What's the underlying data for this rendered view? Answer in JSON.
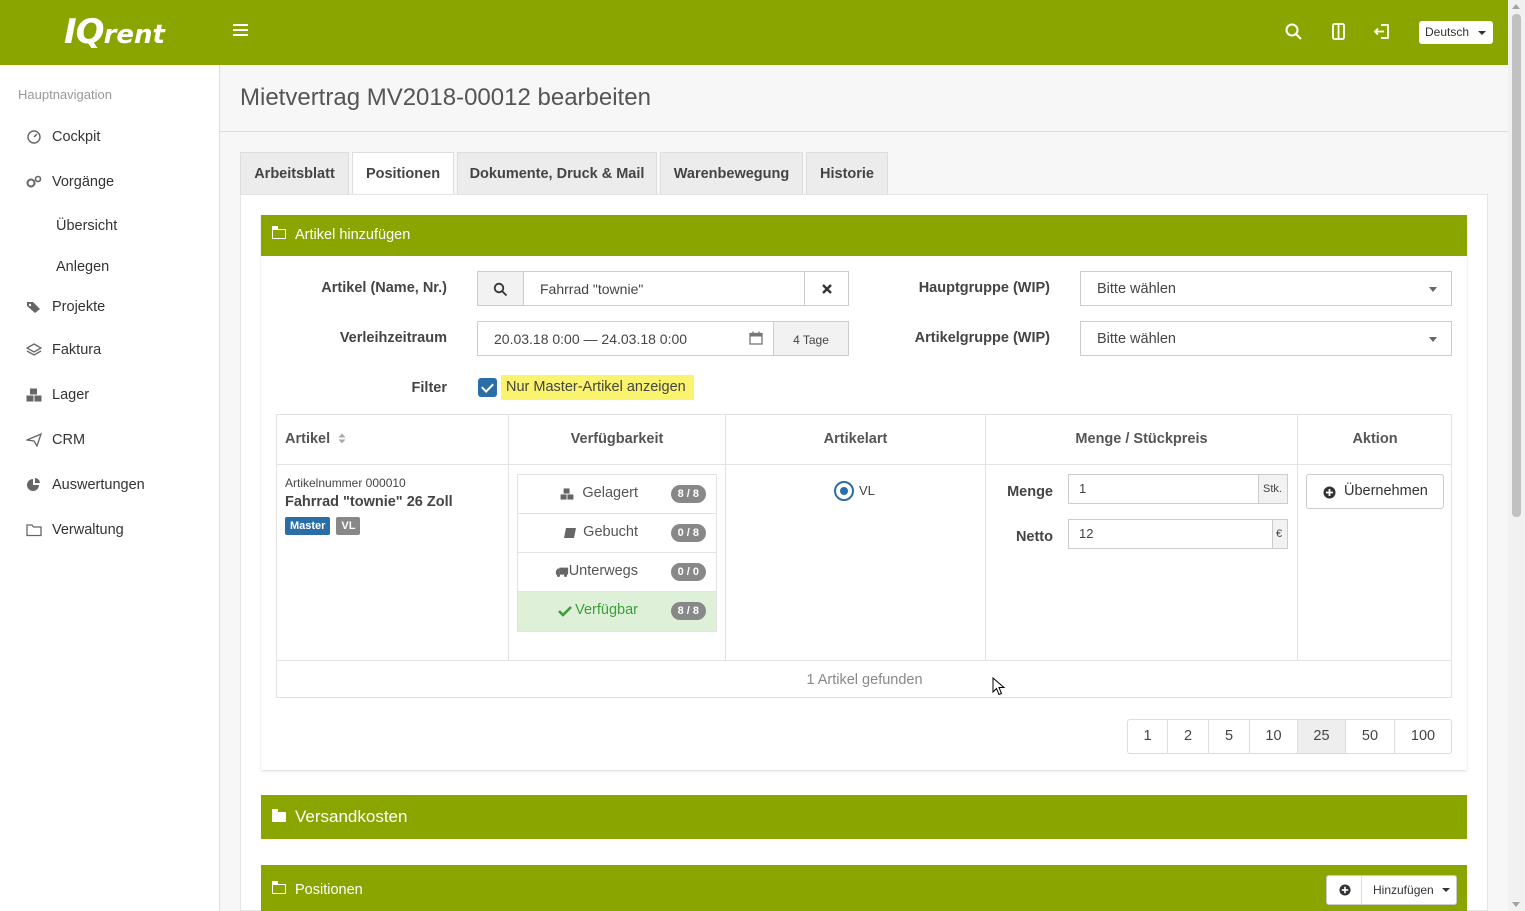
{
  "app": {
    "logo_main": "IQ",
    "logo_rent": "rent",
    "language": "Deutsch"
  },
  "sidebar": {
    "heading": "Hauptnavigation",
    "items": [
      {
        "label": "Cockpit",
        "icon": "gauge-icon"
      },
      {
        "label": "Vorgänge",
        "icon": "gears-icon"
      },
      {
        "label": "Übersicht",
        "sub": true
      },
      {
        "label": "Anlegen",
        "sub": true
      },
      {
        "label": "Projekte",
        "icon": "tags-icon"
      },
      {
        "label": "Faktura",
        "icon": "layers-icon"
      },
      {
        "label": "Lager",
        "icon": "cubes-icon"
      },
      {
        "label": "CRM",
        "icon": "paper-plane-icon"
      },
      {
        "label": "Auswertungen",
        "icon": "pie-chart-icon"
      },
      {
        "label": "Verwaltung",
        "icon": "folder-icon"
      }
    ]
  },
  "page": {
    "title": "Mietvertrag MV2018-00012 bearbeiten"
  },
  "tabs": [
    "Arbeitsblatt",
    "Positionen",
    "Dokumente, Druck & Mail",
    "Warenbewegung",
    "Historie"
  ],
  "active_tab": "Positionen",
  "add_article": {
    "title": "Artikel hinzufügen",
    "article_label": "Artikel (Name, Nr.)",
    "article_value": "Fahrrad \"townie\"",
    "period_label": "Verleihzeitraum",
    "period_value": "20.03.18 0:00 — 24.03.18 0:00",
    "period_days": "4 Tage",
    "filter_label": "Filter",
    "filter_text": "Nur Master-Artikel anzeigen",
    "filter_checked": true,
    "hauptgruppe_label": "Hauptgruppe (WIP)",
    "hauptgruppe_value": "Bitte wählen",
    "artikelgruppe_label": "Artikelgruppe (WIP)",
    "artikelgruppe_value": "Bitte wählen"
  },
  "table": {
    "headers": [
      "Artikel",
      "Verfügbarkeit",
      "Artikelart",
      "Menge / Stückpreis",
      "Aktion"
    ],
    "row": {
      "number": "Artikelnummer 000010",
      "name": "Fahrrad \"townie\" 26 Zoll",
      "badges": [
        "Master",
        "VL"
      ],
      "availability": [
        {
          "label": "Gelagert",
          "count": "8 / 8",
          "icon": "cubes-icon"
        },
        {
          "label": "Gebucht",
          "count": "0 / 8",
          "icon": "book-icon"
        },
        {
          "label": "Unterwegs",
          "count": "0 / 0",
          "icon": "truck-icon"
        },
        {
          "label": "Verfügbar",
          "count": "8 / 8",
          "icon": "check-icon"
        }
      ],
      "art": "VL",
      "menge_label": "Menge",
      "menge_value": "1",
      "menge_unit": "Stk.",
      "netto_label": "Netto",
      "netto_value": "12",
      "netto_unit": "€",
      "action": "Übernehmen"
    },
    "found": "1 Artikel gefunden",
    "page_sizes": [
      "1",
      "2",
      "5",
      "10",
      "25",
      "50",
      "100"
    ],
    "active_page_size": "25"
  },
  "versand": {
    "title": "Versandkosten"
  },
  "positionen": {
    "title": "Positionen",
    "add_button": "Hinzufügen"
  },
  "colors": {
    "brand": "#8aa500",
    "primary": "#2a6ea8",
    "highlight": "#f9f36d",
    "badge_master": "#2a6ea8",
    "badge_vl": "#888888"
  }
}
